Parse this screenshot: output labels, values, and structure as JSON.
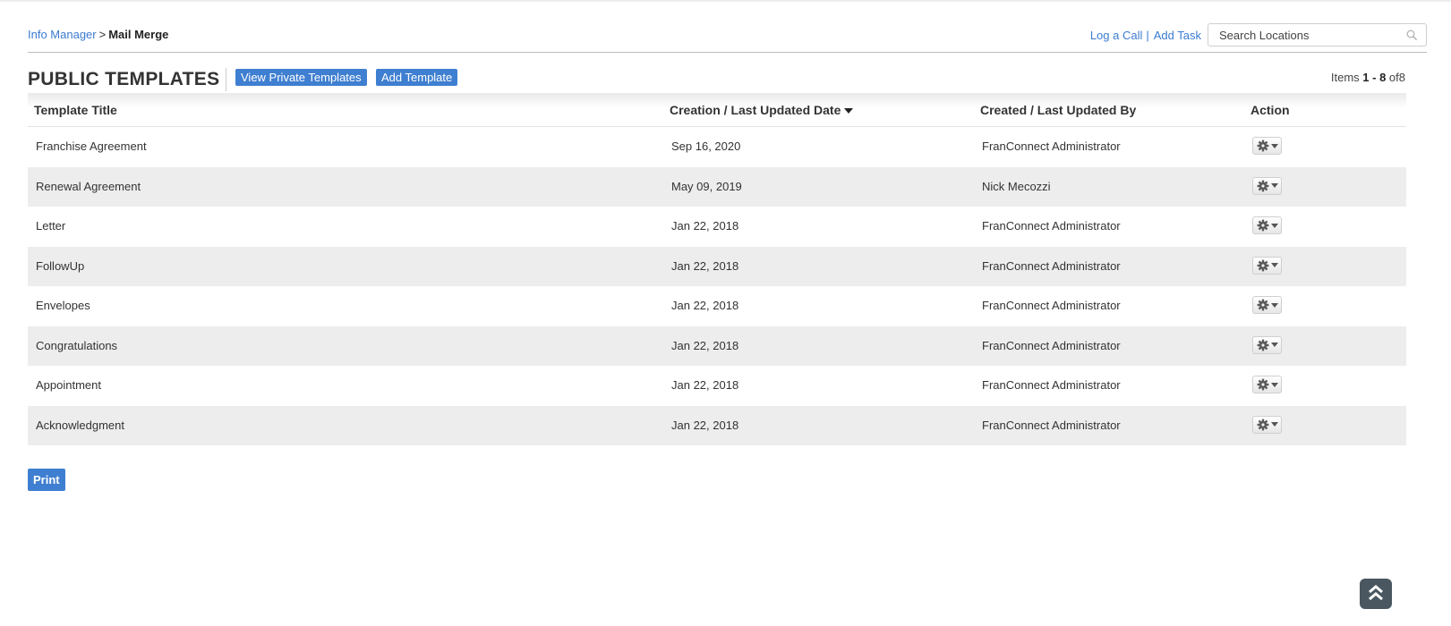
{
  "breadcrumb": {
    "parent": "Info Manager",
    "separator": ">",
    "current": "Mail Merge"
  },
  "top_actions": {
    "log_call": "Log a Call",
    "pipe": "|",
    "add_task": "Add Task"
  },
  "search": {
    "placeholder": "Search Locations",
    "value": ""
  },
  "header": {
    "title": "PUBLIC TEMPLATES",
    "view_private_label": "View Private Templates",
    "add_template_label": "Add Template"
  },
  "items_count": {
    "prefix": "Items",
    "range": "1 - 8",
    "of_text": "of",
    "total": "8"
  },
  "table": {
    "columns": [
      "Template Title",
      "Creation / Last Updated Date",
      "Created / Last Updated By",
      "Action"
    ],
    "rows": [
      {
        "title": "Franchise Agreement",
        "date": "Sep 16, 2020",
        "by": "FranConnect Administrator"
      },
      {
        "title": "Renewal Agreement",
        "date": "May 09, 2019",
        "by": "Nick Mecozzi"
      },
      {
        "title": "Letter",
        "date": "Jan 22, 2018",
        "by": "FranConnect Administrator"
      },
      {
        "title": "FollowUp",
        "date": "Jan 22, 2018",
        "by": "FranConnect Administrator"
      },
      {
        "title": "Envelopes",
        "date": "Jan 22, 2018",
        "by": "FranConnect Administrator"
      },
      {
        "title": "Congratulations",
        "date": "Jan 22, 2018",
        "by": "FranConnect Administrator"
      },
      {
        "title": "Appointment",
        "date": "Jan 22, 2018",
        "by": "FranConnect Administrator"
      },
      {
        "title": "Acknowledgment",
        "date": "Jan 22, 2018",
        "by": "FranConnect Administrator"
      }
    ]
  },
  "footer": {
    "print_label": "Print"
  },
  "icons": {
    "search": "search-icon",
    "sort": "sort-desc-icon",
    "action": "gear-icon",
    "scroll_top": "double-chevron-up-icon"
  },
  "colors": {
    "link": "#3b7bd0",
    "button": "#3f7fd1",
    "alt_row": "#ededed",
    "scroll_top": "#4a5760"
  }
}
